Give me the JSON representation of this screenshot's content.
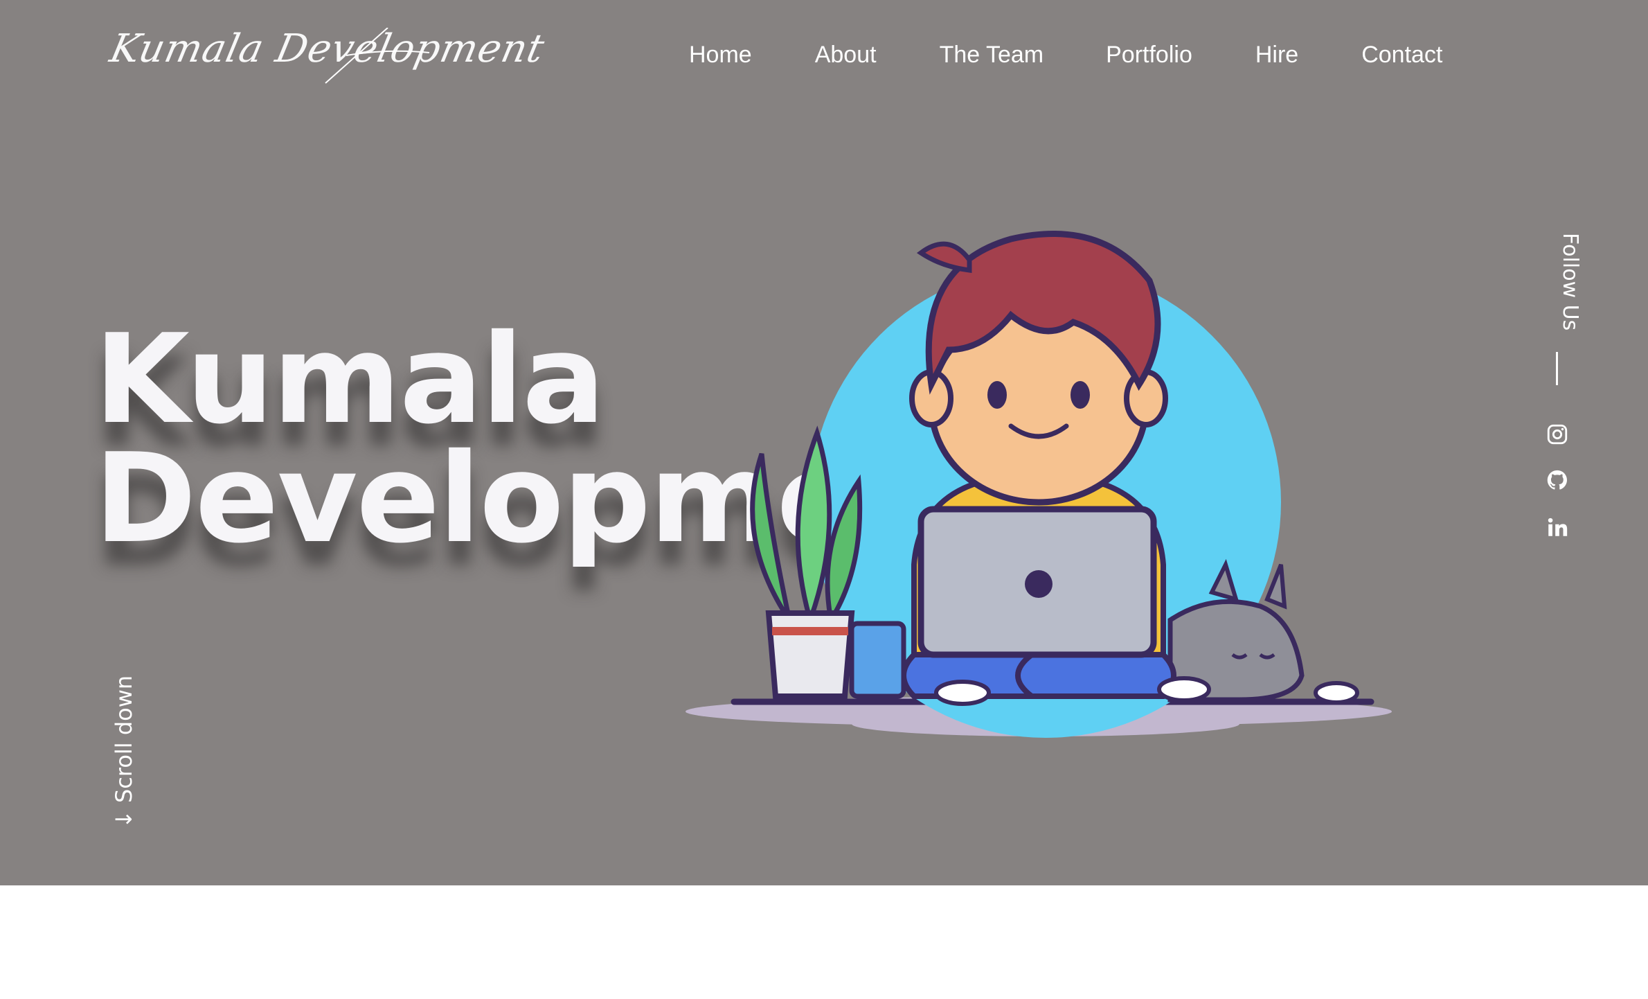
{
  "brand": {
    "logo_text": "Kumala Development"
  },
  "nav": {
    "items": [
      {
        "label": "Home"
      },
      {
        "label": "About"
      },
      {
        "label": "The Team"
      },
      {
        "label": "Portfolio"
      },
      {
        "label": "Hire"
      },
      {
        "label": "Contact"
      }
    ]
  },
  "hero": {
    "headline_line1": "Kumala",
    "headline_line2": "Developme",
    "scroll_label": "↓ Scroll down",
    "background_color": "#868281"
  },
  "social": {
    "label": "Follow Us",
    "icons": [
      "instagram-icon",
      "github-icon",
      "linkedin-icon"
    ]
  }
}
